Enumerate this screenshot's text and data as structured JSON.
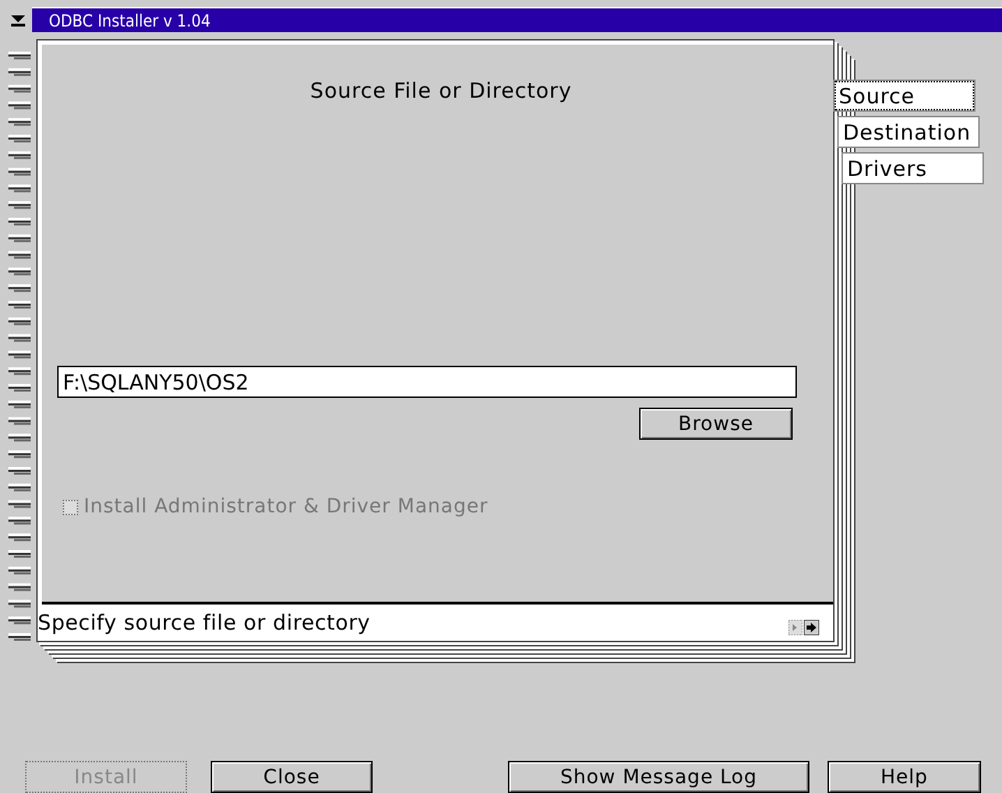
{
  "window": {
    "title": "ODBC Installer v 1.04"
  },
  "page": {
    "heading": "Source File or Directory",
    "path_field": {
      "value": "F:\\SQLANY50\\OS2"
    },
    "browse_button": "Browse",
    "checkbox": {
      "label": "Install Administrator & Driver Manager",
      "checked": false,
      "disabled": true
    },
    "status": "Specify source file or directory"
  },
  "tabs": [
    {
      "label": "Source",
      "selected": true
    },
    {
      "label": "Destination",
      "selected": false
    },
    {
      "label": "Drivers",
      "selected": false
    }
  ],
  "buttons": [
    {
      "label": "Install",
      "disabled": true
    },
    {
      "label": "Close",
      "disabled": false
    },
    {
      "label": "Show Message Log",
      "disabled": false
    },
    {
      "label": "Help",
      "disabled": false
    }
  ]
}
